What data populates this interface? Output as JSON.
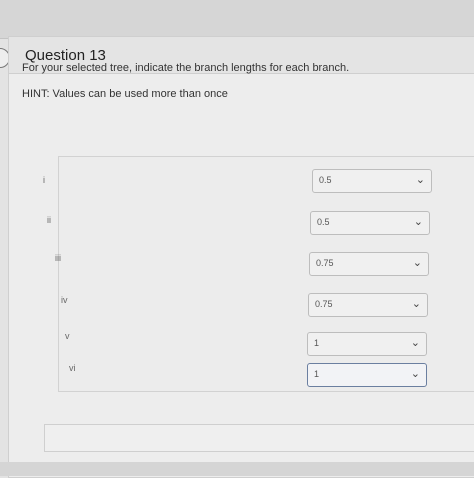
{
  "question": {
    "title": "Question 13",
    "instruction": "For your selected tree, indicate the branch lengths for each branch.",
    "hint": "HINT: Values can be used more than once"
  },
  "rows": [
    {
      "label": "i",
      "value": "0.5"
    },
    {
      "label": "ii",
      "value": "0.5"
    },
    {
      "label": "iii",
      "value": "0.75"
    },
    {
      "label": "iv",
      "value": "0.75"
    },
    {
      "label": "v",
      "value": "1"
    },
    {
      "label": "vi",
      "value": "1"
    }
  ],
  "icons": {
    "dropdown": "chevron-down-icon"
  },
  "colors": {
    "active_border": "#6b7fa0"
  }
}
